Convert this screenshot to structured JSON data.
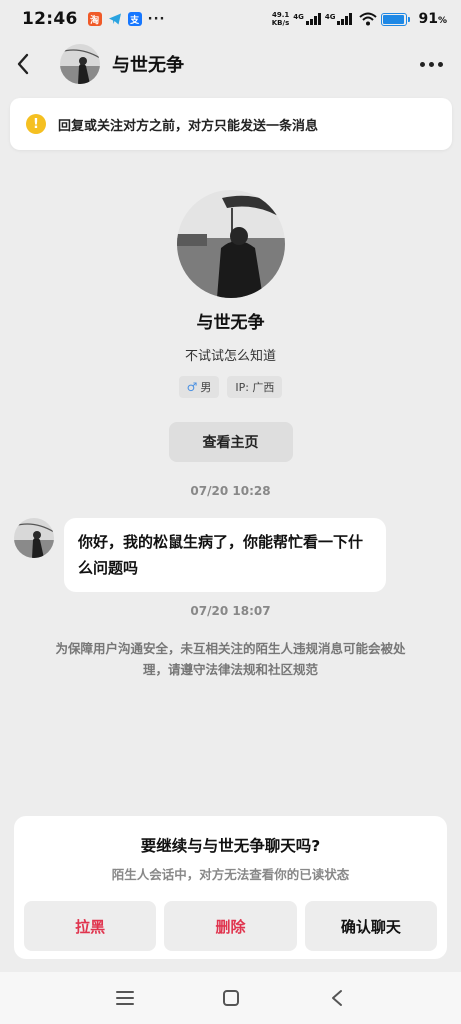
{
  "status_bar": {
    "time": "12:46",
    "notification_icons": [
      "taobao-icon",
      "telegram-icon",
      "alipay-icon"
    ],
    "notif_labels": {
      "taobao": "淘",
      "alipay": "支"
    },
    "more": "···",
    "net_speed_value": "49.1",
    "net_speed_unit": "KB/s",
    "signal1_label": "4G",
    "signal2_label": "4G",
    "battery_percent": "91",
    "battery_unit": "%",
    "battery_level": 0.91,
    "battery_color": "#1e88e5"
  },
  "header": {
    "title": "与世无争",
    "back_icon": "chevron-left-icon",
    "menu_icon": "more-horizontal-icon"
  },
  "notice": {
    "icon": "warning-icon",
    "icon_glyph": "!",
    "text": "回复或关注对方之前，对方只能发送一条消息",
    "icon_color": "#f5c021"
  },
  "profile": {
    "name": "与世无争",
    "signature": "不试试怎么知道",
    "gender_icon": "♂",
    "gender": "男",
    "ip": "IP: 广西",
    "view_home_label": "查看主页"
  },
  "chat": {
    "timestamp1": "07/20 10:28",
    "message": "你好，我的松鼠生病了，你能帮忙看一下什么问题吗",
    "timestamp2": "07/20 18:07",
    "safety_note": "为保障用户沟通安全，未互相关注的陌生人违规消息可能会被处理，请遵守法律法规和社区规范"
  },
  "sheet": {
    "title": "要继续与与世无争聊天吗?",
    "subtitle": "陌生人会话中，对方无法查看你的已读状态",
    "block_label": "拉黑",
    "delete_label": "删除",
    "confirm_label": "确认聊天",
    "danger_color": "#e0344e"
  },
  "navbar": {
    "icons": [
      "menu-icon",
      "home-square-icon",
      "back-triangle-icon"
    ]
  }
}
